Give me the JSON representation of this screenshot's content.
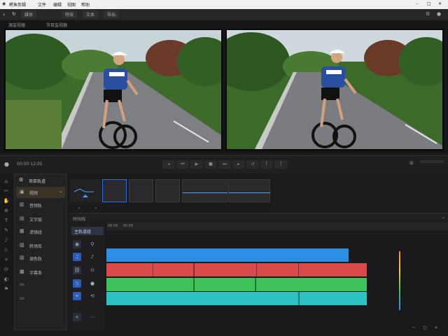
{
  "app": {
    "title": "鳄鱼剪辑",
    "menus": [
      "文件",
      "编辑",
      "视图",
      "帮助"
    ]
  },
  "toolbar": {
    "tabs": [
      "媒体",
      "特效",
      "文本",
      "导出"
    ]
  },
  "viewers": {
    "source_label": "源监视器",
    "program_label": "节目监视器"
  },
  "controls": {
    "timecode": "00:00:12:05"
  },
  "track_panel": {
    "header": "项目轨道",
    "items": [
      "视频",
      "音频轨",
      "文字层",
      "滤镜组",
      "转场库",
      "调色轨",
      "字幕条"
    ]
  },
  "timeline": {
    "header": "时间线",
    "track_label": "主轨道组",
    "ruler_marks": [
      "00:00",
      "00:05"
    ]
  },
  "colors": {
    "clip_blue": "#2b8fe6",
    "clip_red": "#d94b4b",
    "clip_green": "#3fc25a",
    "clip_cyan": "#2dc2c2",
    "playhead": "#ff8c1a"
  }
}
